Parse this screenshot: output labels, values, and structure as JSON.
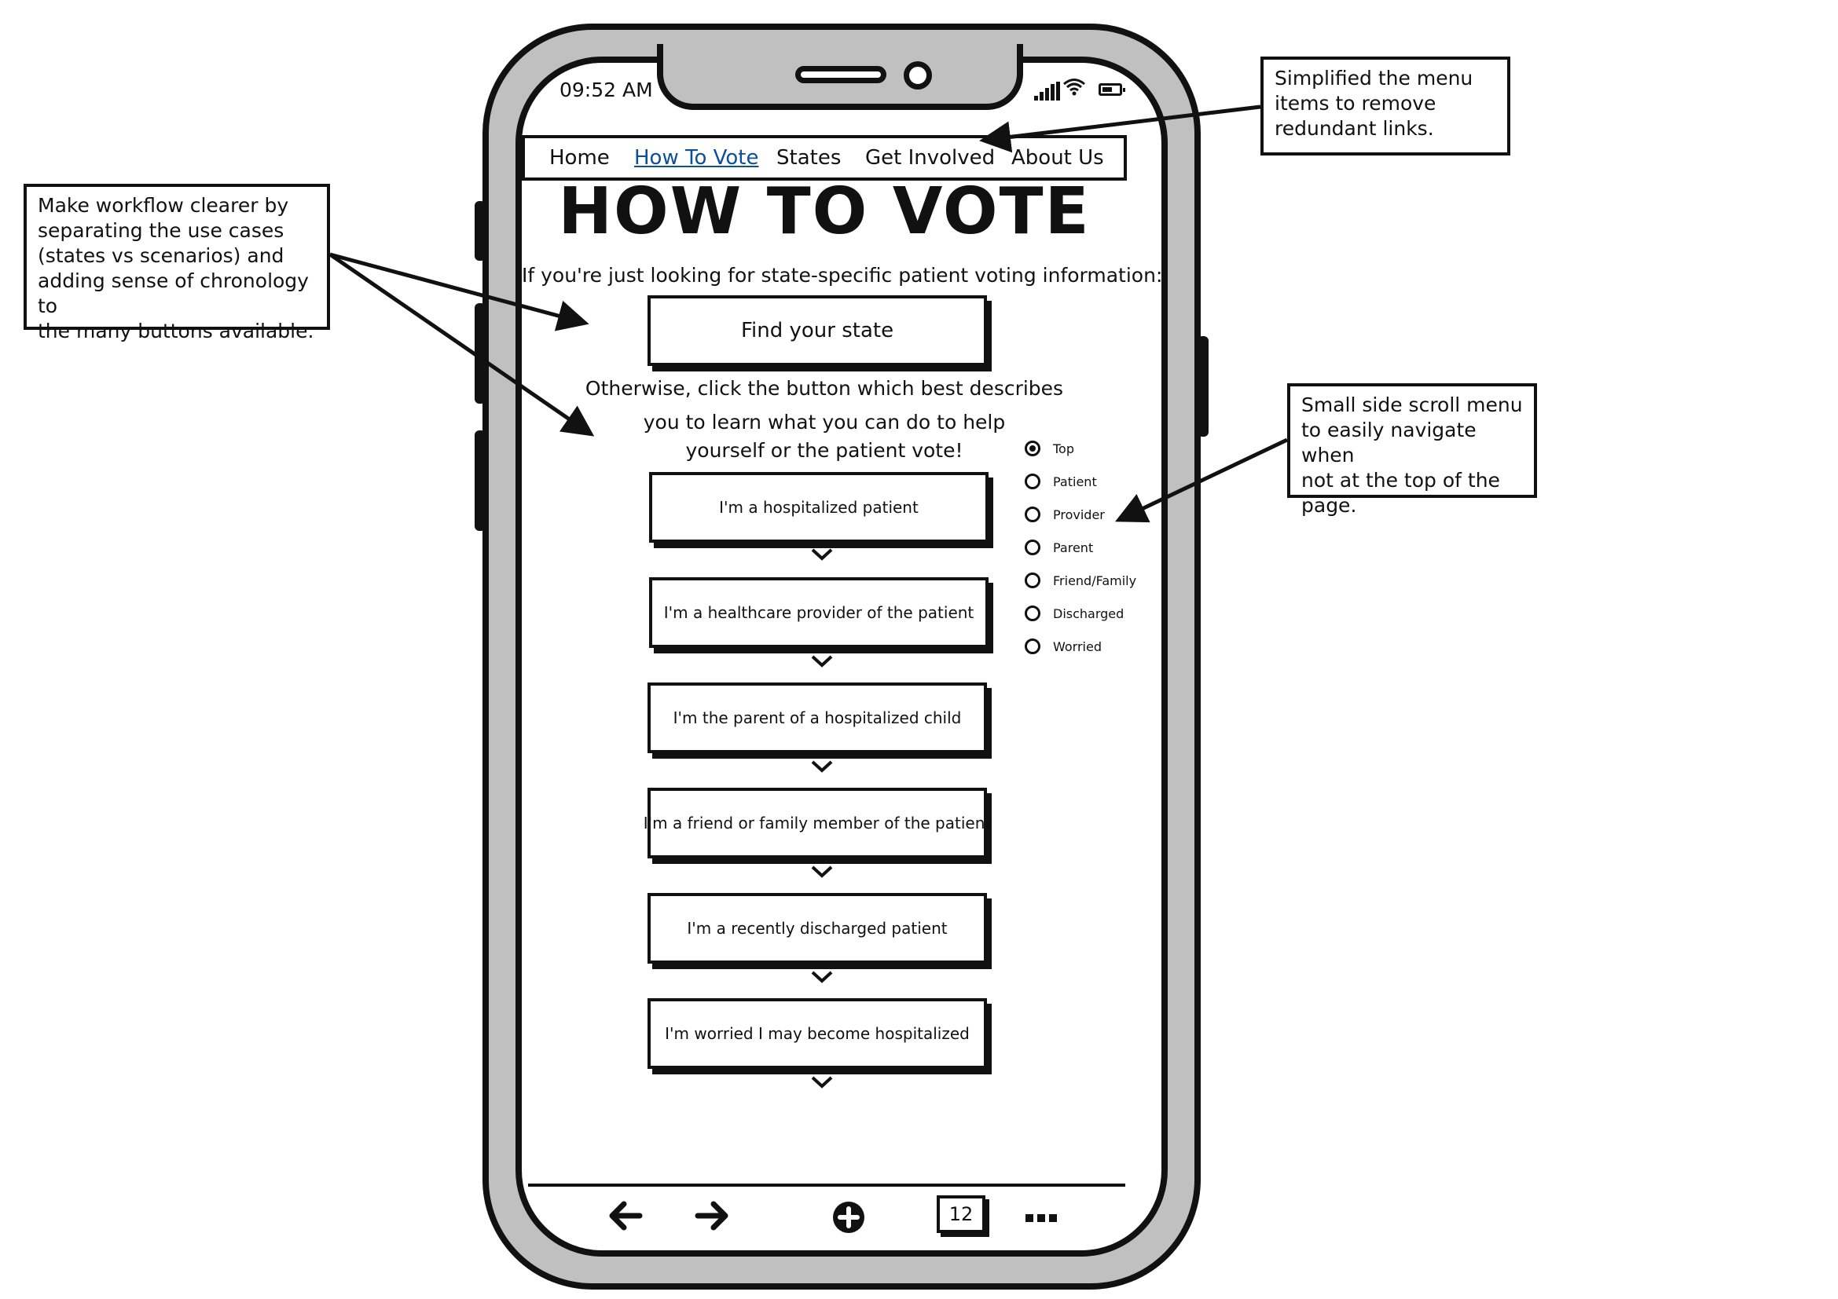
{
  "status_bar": {
    "time": "09:52 AM"
  },
  "nav": {
    "items": [
      "Home",
      "How To Vote",
      "States",
      "Get Involved",
      "About Us"
    ],
    "active_index": 1
  },
  "page": {
    "title": "HOW TO VOTE",
    "state_prompt": "If you're just looking for state-specific patient voting information:",
    "find_state_label": "Find your state",
    "otherwise_lines": [
      "Otherwise, click the button which best describes",
      "you to learn what you can do to help",
      "yourself or the patient vote!"
    ],
    "scenarios": [
      "I'm a hospitalized patient",
      "I'm a healthcare provider of the patient",
      "I'm the parent of a hospitalized child",
      "I'm a friend or family member of the patient",
      "I'm a recently discharged patient",
      "I'm worried I may become hospitalized"
    ]
  },
  "side_menu": {
    "items": [
      "Top",
      "Patient",
      "Provider",
      "Parent",
      "Friend/Family",
      "Discharged",
      "Worried"
    ],
    "selected": "Top"
  },
  "toolbar": {
    "tab_count": "12",
    "icons": [
      "back-arrow-icon",
      "forward-arrow-icon",
      "new-tab-plus-icon",
      "tabs-icon",
      "more-dots-icon"
    ]
  },
  "annotations": {
    "menu_note": "Simplified the menu items to remove redundant links.",
    "menu_note_lines": [
      "Simplified the menu",
      "items to remove",
      "redundant links."
    ],
    "workflow_note": "Make workflow clearer by separating the use cases (states vs scenarios) and adding sense of chronology to the many buttons available.",
    "workflow_note_lines": [
      "Make workflow clearer by",
      "separating the use cases",
      "(states vs scenarios) and",
      "adding sense of chronology to",
      "the many buttons available."
    ],
    "side_menu_note": "Small side scroll menu to easily navigate when not at the top of the page.",
    "side_menu_note_lines": [
      "Small side scroll menu",
      "to easily navigate when",
      "not at the top of the",
      "page."
    ]
  }
}
